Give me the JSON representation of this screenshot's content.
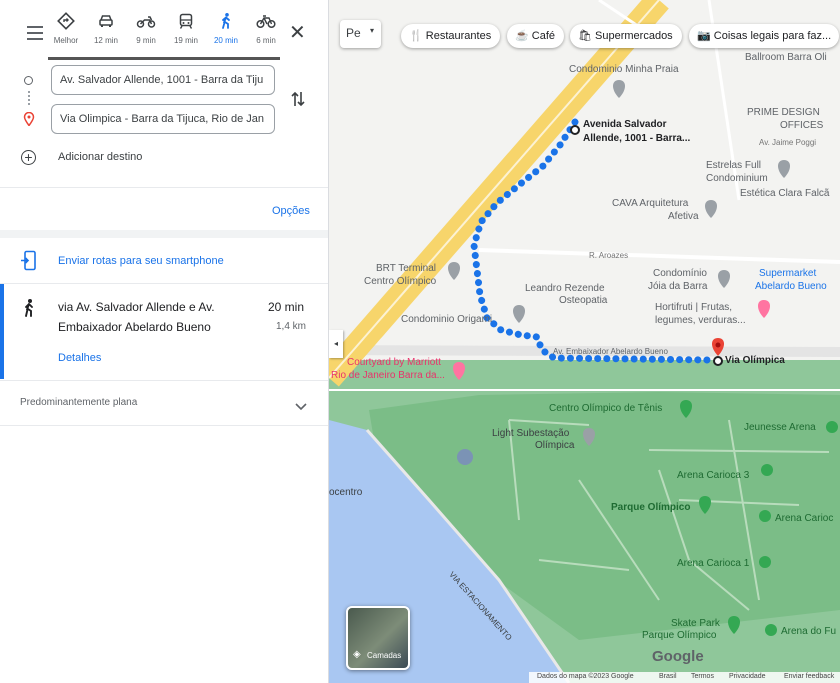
{
  "travel_modes": [
    {
      "name": "best",
      "label": "Melhor"
    },
    {
      "name": "car",
      "label": "12 min"
    },
    {
      "name": "motorcycle",
      "label": "9 min"
    },
    {
      "name": "transit",
      "label": "19 min"
    },
    {
      "name": "walk",
      "label": "20 min",
      "selected": true
    },
    {
      "name": "bike",
      "label": "6 min"
    }
  ],
  "origin": {
    "value": "Av. Salvador Allende, 1001 - Barra da Tiju"
  },
  "destination": {
    "value": "Via Olimpica - Barra da Tijuca, Rio de Jan"
  },
  "add_destination": "Adicionar destino",
  "options": "Opções",
  "send_to_phone": "Enviar rotas para seu smartphone",
  "route": {
    "line1": "via Av. Salvador Allende e Av.",
    "line2": "Embaixador Abelardo Bueno",
    "duration": "20 min",
    "distance": "1,4 km",
    "details": "Detalhes"
  },
  "elevation": "Predominantemente plana",
  "map": {
    "search_placeholder": "Pe",
    "chips": [
      "Restaurantes",
      "Café",
      "Supermercados",
      "Coisas legais para faz..."
    ],
    "layers": "Camadas",
    "google": "Google",
    "footer": [
      "Dados do mapa ©2023 Google",
      "Brasil",
      "Termos",
      "Privacidade",
      "Enviar feedback"
    ],
    "labels": {
      "ballroom": "Ballroom Barra Oli",
      "minha_praia": "Condominio Minha Praia",
      "origin_1": "Avenida Salvador",
      "origin_2": "Allende, 1001 -  Barra...",
      "prime_1": "PRIME DESIGN",
      "prime_2": "OFFICES",
      "jaime": "Av. Jaime Poggi",
      "estrelas_1": "Estrelas Full",
      "estrelas_2": "Condominium",
      "estetica": "Estética Clara Falcã",
      "cava_1": "CAVA Arquitetura",
      "cava_2": "Afetiva",
      "aroazes": "R. Aroazes",
      "brt_1": "BRT Terminal",
      "brt_2": "Centro Olímpico",
      "joia_1": "Condomínio",
      "joia_2": "Jóia da Barra",
      "super_1": "Supermarket",
      "super_2": "Abelardo Bueno",
      "leandro_1": "Leandro Rezende",
      "leandro_2": "Osteopatia",
      "hortifruti_1": "Hortifruti | Frutas,",
      "hortifruti_2": "legumes, verduras...",
      "origami": "Condominio Origami",
      "av_emb": "Av. Embaixador Abelardo Bueno",
      "via_olimpica": "Via Olímpica",
      "courtyard_1": "Courtyard by Marriott",
      "courtyard_2": "Rio de Janeiro Barra da...",
      "tenis": "Centro Olímpico de Tênis",
      "subestacao_1": "Light Subestação",
      "subestacao_2": "Olímpica",
      "jeunesse": "Jeunesse Arena",
      "carioca3": "Arena Carioca 3",
      "centro": "ocentro",
      "parque": "Parque Olímpico",
      "arena_carioca": "Arena Carioc",
      "carioca1": "Arena Carioca 1",
      "estacionamento": "VIA ESTACIONAMENTO",
      "skate_1": "Skate Park",
      "skate_2": "Parque Olímpico",
      "arena_fu": "Arena do Fu"
    }
  }
}
